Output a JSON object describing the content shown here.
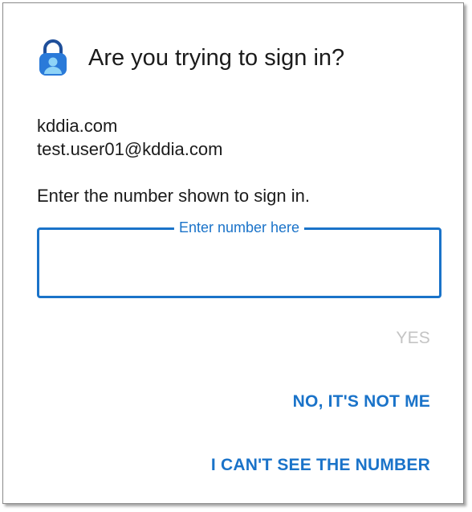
{
  "dialog": {
    "title": "Are you trying to sign in?",
    "icon": "authenticator-lock-icon"
  },
  "account": {
    "domain": "kddia.com",
    "email": "test.user01@kddia.com"
  },
  "instruction": "Enter the number shown to sign in.",
  "number_field": {
    "label": "Enter number here",
    "value": ""
  },
  "actions": {
    "yes_label": "YES",
    "no_label": "NO, IT'S NOT ME",
    "cant_see_label": "I CAN'T SEE THE NUMBER"
  },
  "colors": {
    "accent": "#1a73c9",
    "disabled": "#c4c4c4",
    "text": "#1b1b1b"
  }
}
